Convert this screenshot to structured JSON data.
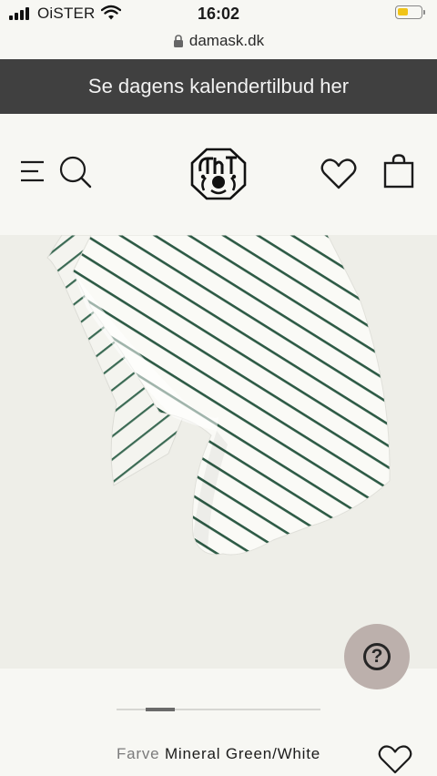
{
  "status_bar": {
    "carrier": "OiSTER",
    "time": "16:02",
    "battery_level": 0.45,
    "battery_color": "#f0c419"
  },
  "browser": {
    "url": "damask.dk",
    "lock_icon": "lock-icon"
  },
  "promo_banner": {
    "text": "Se dagens kalendertilbud her",
    "background": "#404040"
  },
  "header": {
    "icons": [
      "menu-icon",
      "search-icon",
      "logo",
      "heart-icon",
      "shopping-bag-icon"
    ]
  },
  "hero": {
    "alt": "",
    "stripe_color": "#2d5a45",
    "background": "#eeeee8"
  },
  "help_button": {
    "label": "?",
    "background": "#bcb0ac"
  },
  "carousel": {
    "current_slide": 2,
    "total_slides": 7
  },
  "product": {
    "color_label": "Farve",
    "color_value": "Mineral Green/White"
  }
}
